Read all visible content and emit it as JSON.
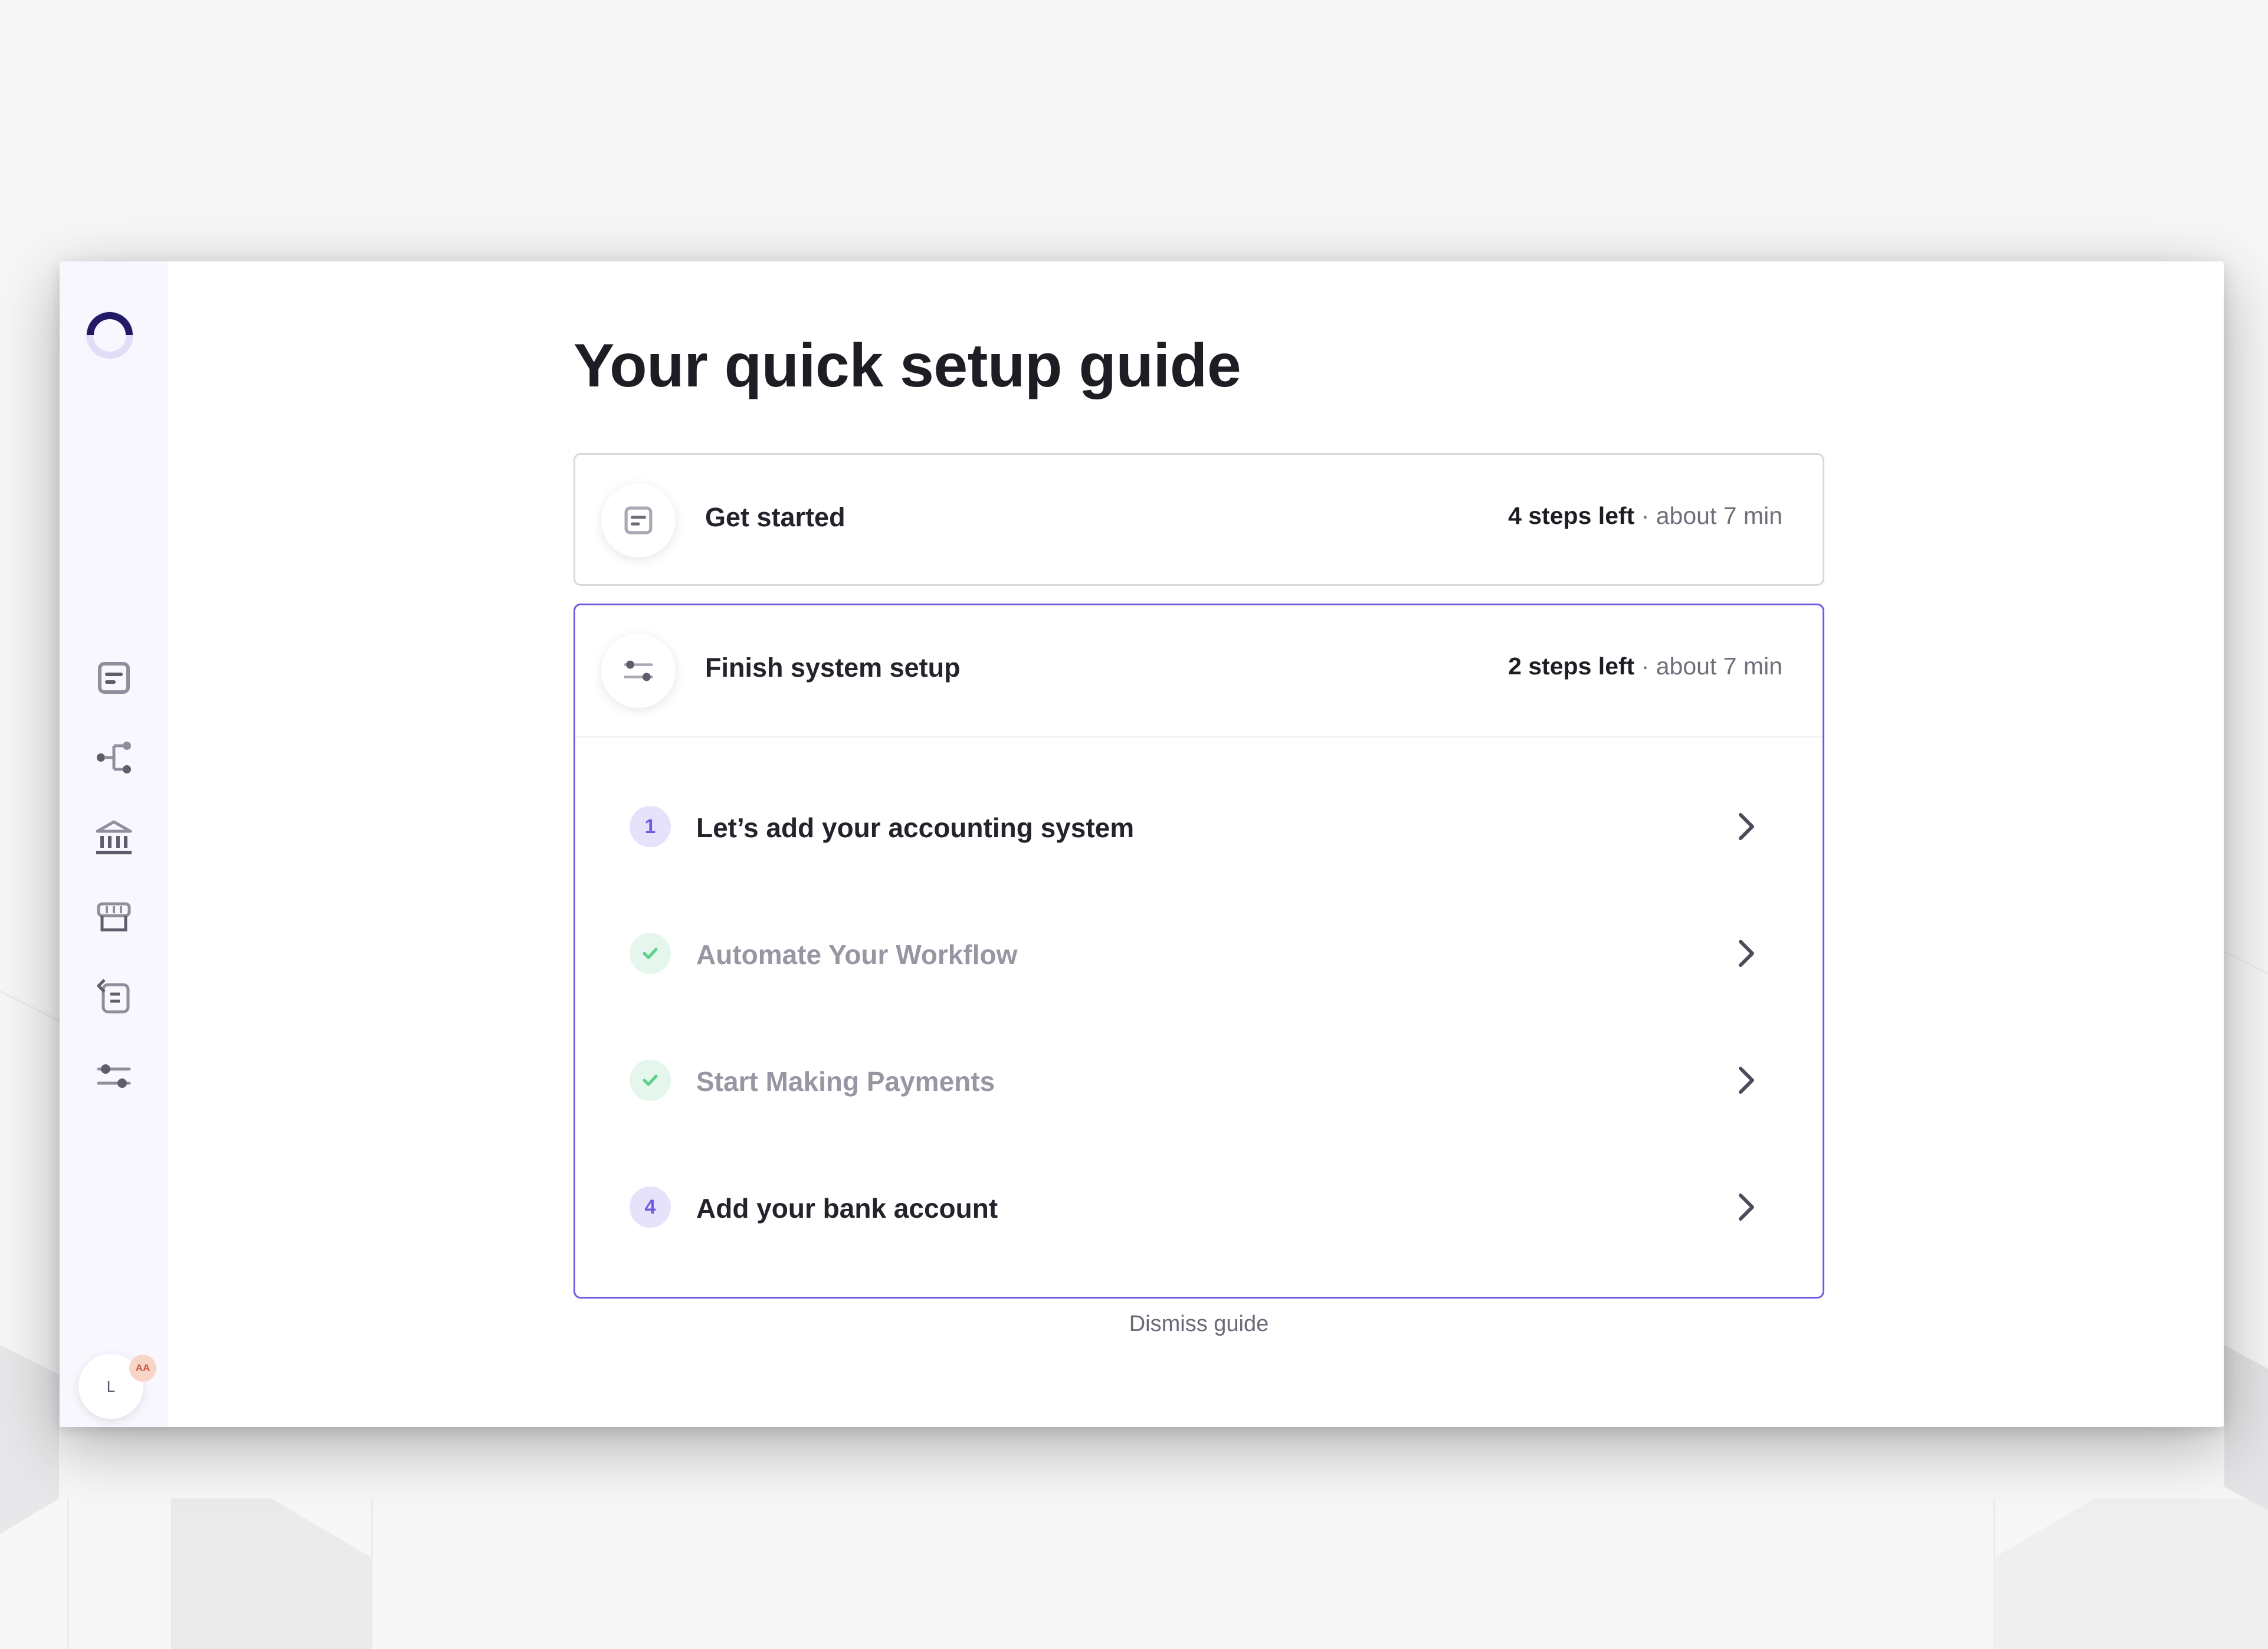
{
  "page_title": "Your quick setup guide",
  "sidebar": {
    "items": [
      {
        "name": "document"
      },
      {
        "name": "workflow"
      },
      {
        "name": "bank"
      },
      {
        "name": "inbox"
      },
      {
        "name": "returns"
      },
      {
        "name": "settings"
      }
    ],
    "avatar_initial": "L",
    "avatar_badge": "AA"
  },
  "cards": [
    {
      "title": "Get started",
      "steps_left": "4 steps left",
      "duration": " · about 7 min",
      "icon": "document-icon"
    },
    {
      "title": "Finish system setup",
      "steps_left": "2 steps left",
      "duration": " · about 7 min",
      "icon": "sliders-icon"
    }
  ],
  "steps": [
    {
      "number": "1",
      "label": "Let’s add your accounting system",
      "done": false
    },
    {
      "number": "",
      "label": "Automate Your Workflow",
      "done": true
    },
    {
      "number": "",
      "label": "Start Making Payments",
      "done": true
    },
    {
      "number": "4",
      "label": "Add your bank account",
      "done": false
    }
  ],
  "dismiss_label": "Dismiss guide",
  "colors": {
    "accent": "#6b5de0",
    "done": "#5ccf8a",
    "text": "#1f1d24",
    "muted": "#9796a3"
  }
}
